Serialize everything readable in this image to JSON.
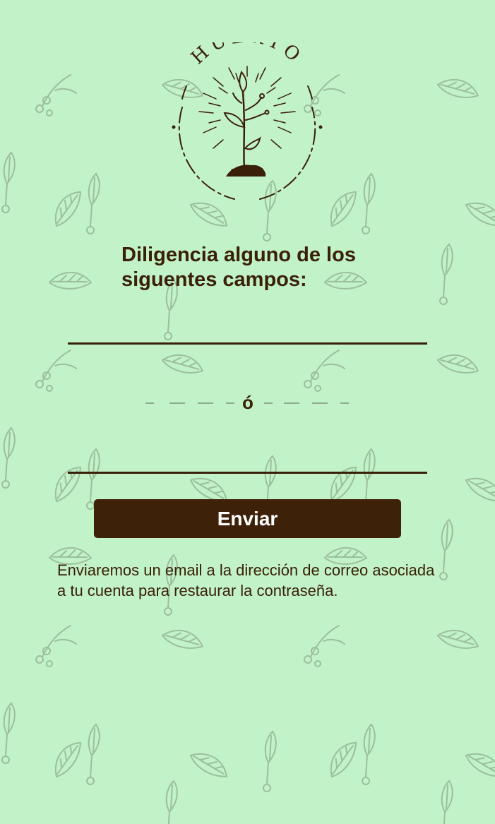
{
  "logo": {
    "wordmark": "HUERTO"
  },
  "form": {
    "heading": "Diligencia alguno de los siguentes campos:",
    "field_1": {
      "value": "",
      "placeholder": ""
    },
    "separator": "ó",
    "field_2": {
      "value": "",
      "placeholder": ""
    },
    "submit_label": "Enviar"
  },
  "note": "Enviaremos un email a la dirección de correo asociada a tu cuenta para restaurar la contraseña.",
  "colors": {
    "background": "#c2f2c8",
    "pattern": "#7f9a7c",
    "brand_brown": "#3e2109"
  },
  "icons": {
    "logo": "sprout-in-circle-icon",
    "pattern": "leaf-sprig-icon"
  }
}
